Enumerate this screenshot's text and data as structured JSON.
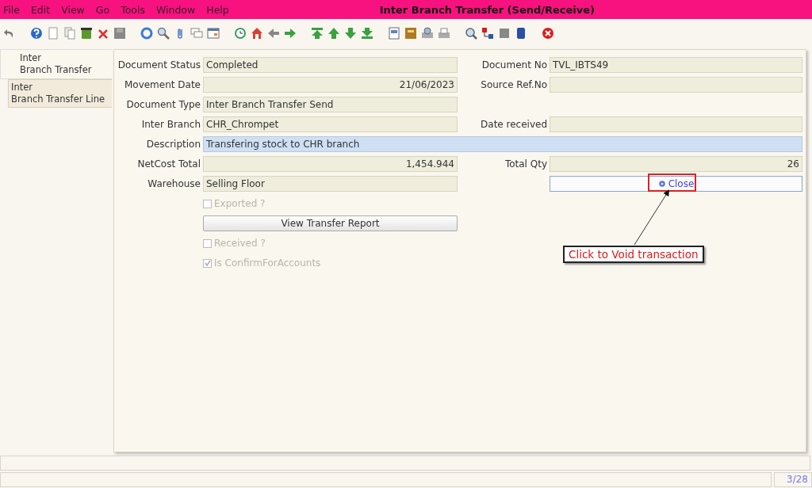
{
  "window": {
    "title": "Inter Branch Transfer (Send/Receive)"
  },
  "menu": [
    "File",
    "Edit",
    "View",
    "Go",
    "Tools",
    "Window",
    "Help"
  ],
  "tabs": [
    {
      "label": "Inter\nBranch Transfer",
      "selected": true
    },
    {
      "label": "Inter\nBranch Transfer Line",
      "selected": false
    }
  ],
  "form": {
    "rows": [
      {
        "left": {
          "kind": "text",
          "label": "Document Status",
          "value": "Completed"
        },
        "right": {
          "kind": "text",
          "label": "Document No",
          "value": "TVL_IBTS49"
        }
      },
      {
        "left": {
          "kind": "number",
          "label": "Movement Date",
          "value": "21/06/2023"
        },
        "right": {
          "kind": "text",
          "label": "Source Ref.No"
        }
      },
      {
        "left": {
          "kind": "text",
          "label": "Document Type",
          "value": "Inter Branch Transfer Send"
        }
      },
      {
        "left": {
          "kind": "text",
          "label": "Inter Branch",
          "value": "CHR_Chrompet"
        },
        "right": {
          "kind": "text",
          "label": "Date received"
        }
      },
      {
        "wide": {
          "kind": "editable",
          "label": "Description",
          "value": "Transfering stock to CHR branch"
        }
      },
      {
        "left": {
          "kind": "number",
          "label": "NetCost Total",
          "value": "1,454.944"
        },
        "right": {
          "kind": "number",
          "label": "Total Qty",
          "value": "26"
        }
      },
      {
        "left": {
          "kind": "text",
          "label": "Warehouse",
          "value": "Selling Floor"
        },
        "right": {
          "kind": "action",
          "label": "Close"
        }
      },
      {
        "left": {
          "kind": "checkbox",
          "label": "Exported ?",
          "checked": false,
          "disabled": true
        }
      },
      {
        "left": {
          "kind": "button",
          "label": "View Transfer Report"
        }
      },
      {
        "left": {
          "kind": "checkbox",
          "label": "Received ?",
          "checked": false,
          "disabled": true
        }
      },
      {
        "left": {
          "kind": "checkbox",
          "label": "Is ConfirmForAccounts",
          "checked": true,
          "disabled": true
        }
      }
    ]
  },
  "annotation": {
    "callout": "Click to Void transaction"
  },
  "status_bar": {
    "record": "3/28"
  }
}
